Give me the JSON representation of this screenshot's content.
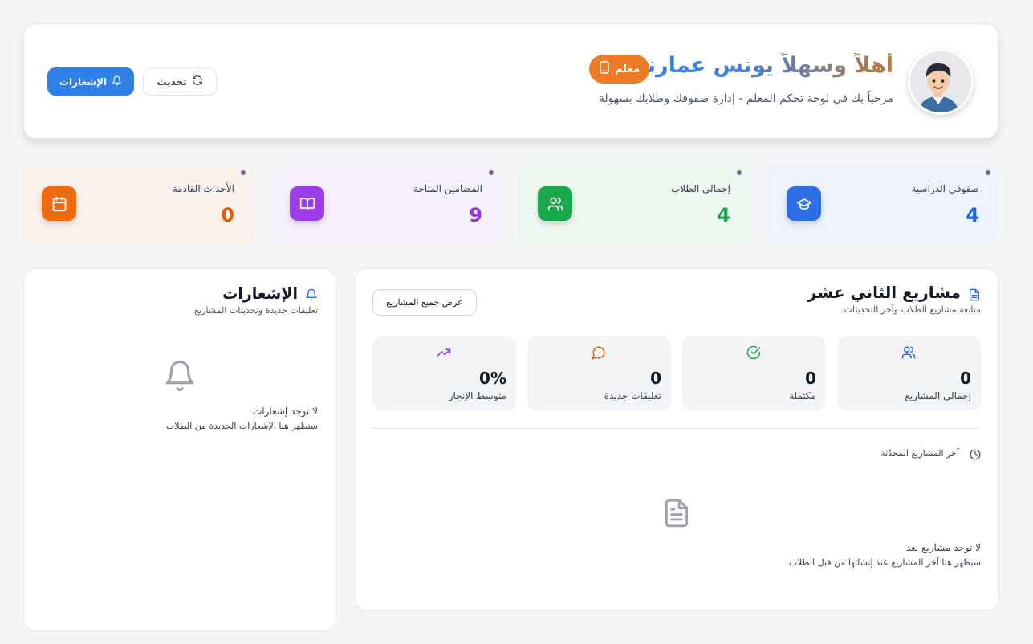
{
  "header": {
    "greeting": "أهلاً وسهلاً يونس عمارنة",
    "role_badge": "معلم",
    "subtitle": "مرحباً بك في لوحة تحكم المعلم - إدارة صفوفك وطلابك بسهولة",
    "notifications_button": "الإشعارات",
    "refresh_button": "تحديث",
    "avatar_icon": "teacher-avatar"
  },
  "stats": [
    {
      "label": "صفوفي الدراسية",
      "value": "4",
      "color": "#2563eb",
      "icon": "graduation-cap-icon"
    },
    {
      "label": "إجمالي الطلاب",
      "value": "4",
      "color": "#16a34a",
      "icon": "users-icon"
    },
    {
      "label": "المضامين المتاحة",
      "value": "9",
      "color": "#9333ea",
      "icon": "book-open-icon"
    },
    {
      "label": "الأحداث القادمة",
      "value": "0",
      "color": "#ea580c",
      "icon": "calendar-icon"
    }
  ],
  "projects": {
    "title": "مشاريع الثاني عشر",
    "subtitle": "متابعة مشاريع الطلاب وآخر التحديثات",
    "view_all": "عرض جميع المشاريع",
    "metrics": [
      {
        "value": "0",
        "label": "إجمالي المشاريع",
        "icon": "users-icon",
        "color": "#2563eb"
      },
      {
        "value": "0",
        "label": "مكتملة",
        "icon": "check-circle-icon",
        "color": "#16a34a"
      },
      {
        "value": "0",
        "label": "تعليقات جديدة",
        "icon": "message-circle-icon",
        "color": "#ea580c"
      },
      {
        "value": "0%",
        "label": "متوسط الإنجاز",
        "icon": "trending-up-icon",
        "color": "#9333ea"
      }
    ],
    "recent_label": "آخر المشاريع المحدّثة",
    "empty_title": "لا توجد مشاريع بعد",
    "empty_subtitle": "سيظهر هنا آخر المشاريع عند إنشائها من قبل الطلاب"
  },
  "notifications": {
    "title": "الإشعارات",
    "subtitle": "تعليقات جديدة وتحديثات المشاريع",
    "empty_title": "لا توجد إشعارات",
    "empty_subtitle": "ستظهر هنا الإشعارات الجديدة من الطلاب"
  }
}
